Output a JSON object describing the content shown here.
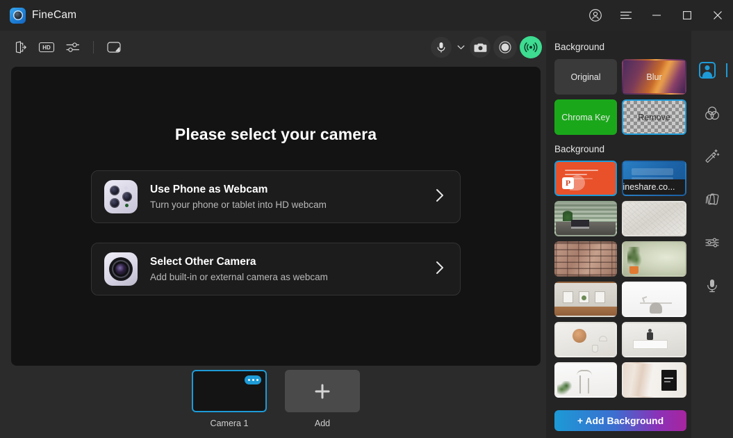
{
  "window": {
    "app_title": "FineCam",
    "logo_icon": "finecam-logo-icon",
    "controls": {
      "account": "account-icon",
      "menu": "hamburger-menu-icon",
      "minimize": "minimize-icon",
      "maximize": "maximize-icon",
      "close": "close-icon"
    }
  },
  "toolbar": {
    "left_items": [
      {
        "name": "exit-icon",
        "label": "Exit"
      },
      {
        "name": "hd-icon",
        "label": "HD"
      },
      {
        "name": "settings-sliders-icon",
        "label": "Settings"
      },
      {
        "name": "whiteboard-icon",
        "label": "Whiteboard"
      }
    ],
    "right_items": [
      {
        "name": "microphone-icon",
        "label": "Microphone"
      },
      {
        "name": "chevron-down-icon",
        "label": "Microphone options"
      },
      {
        "name": "snapshot-camera-icon",
        "label": "Snapshot"
      },
      {
        "name": "record-icon",
        "label": "Record"
      },
      {
        "name": "broadcast-live-icon",
        "label": "Go Live"
      }
    ],
    "hd_label": "HD",
    "live_color": "#3ddc91"
  },
  "preview": {
    "title": "Please select your camera",
    "options": [
      {
        "icon": "phone-camera-icon",
        "title": "Use Phone as Webcam",
        "subtitle": "Turn your phone or tablet into HD webcam",
        "arrow": "chevron-right-icon"
      },
      {
        "icon": "camera-lens-icon",
        "title": "Select Other Camera",
        "subtitle": "Add built-in or external camera as webcam",
        "arrow": "chevron-right-icon"
      }
    ]
  },
  "camera_strip": {
    "items": [
      {
        "label": "Camera 1",
        "selected": true,
        "badge": "more-options-icon"
      },
      {
        "label": "Add",
        "selected": false,
        "badge": "plus-icon"
      }
    ]
  },
  "right_panel": {
    "section_modes_title": "Background",
    "modes": [
      {
        "label": "Original",
        "selected": false
      },
      {
        "label": "Blur",
        "selected": false
      },
      {
        "label": "Chroma Key",
        "selected": false
      },
      {
        "label": "Remove",
        "selected": true
      }
    ],
    "section_library_title": "Background",
    "tooltip": "fineshare.co...",
    "add_button": "+ Add Background",
    "accent_color": "#1e9bd7",
    "chroma_color": "#1aa81a"
  },
  "rail": {
    "items": [
      {
        "name": "background-person-icon",
        "label": "Background",
        "active": true
      },
      {
        "name": "color-filters-icon",
        "label": "Filters",
        "active": false
      },
      {
        "name": "magic-wand-icon",
        "label": "Effects",
        "active": false
      },
      {
        "name": "layers-cards-icon",
        "label": "Layers",
        "active": false
      },
      {
        "name": "adjust-sliders-icon",
        "label": "Adjust",
        "active": false
      },
      {
        "name": "audio-microphone-icon",
        "label": "Audio",
        "active": false
      }
    ]
  }
}
